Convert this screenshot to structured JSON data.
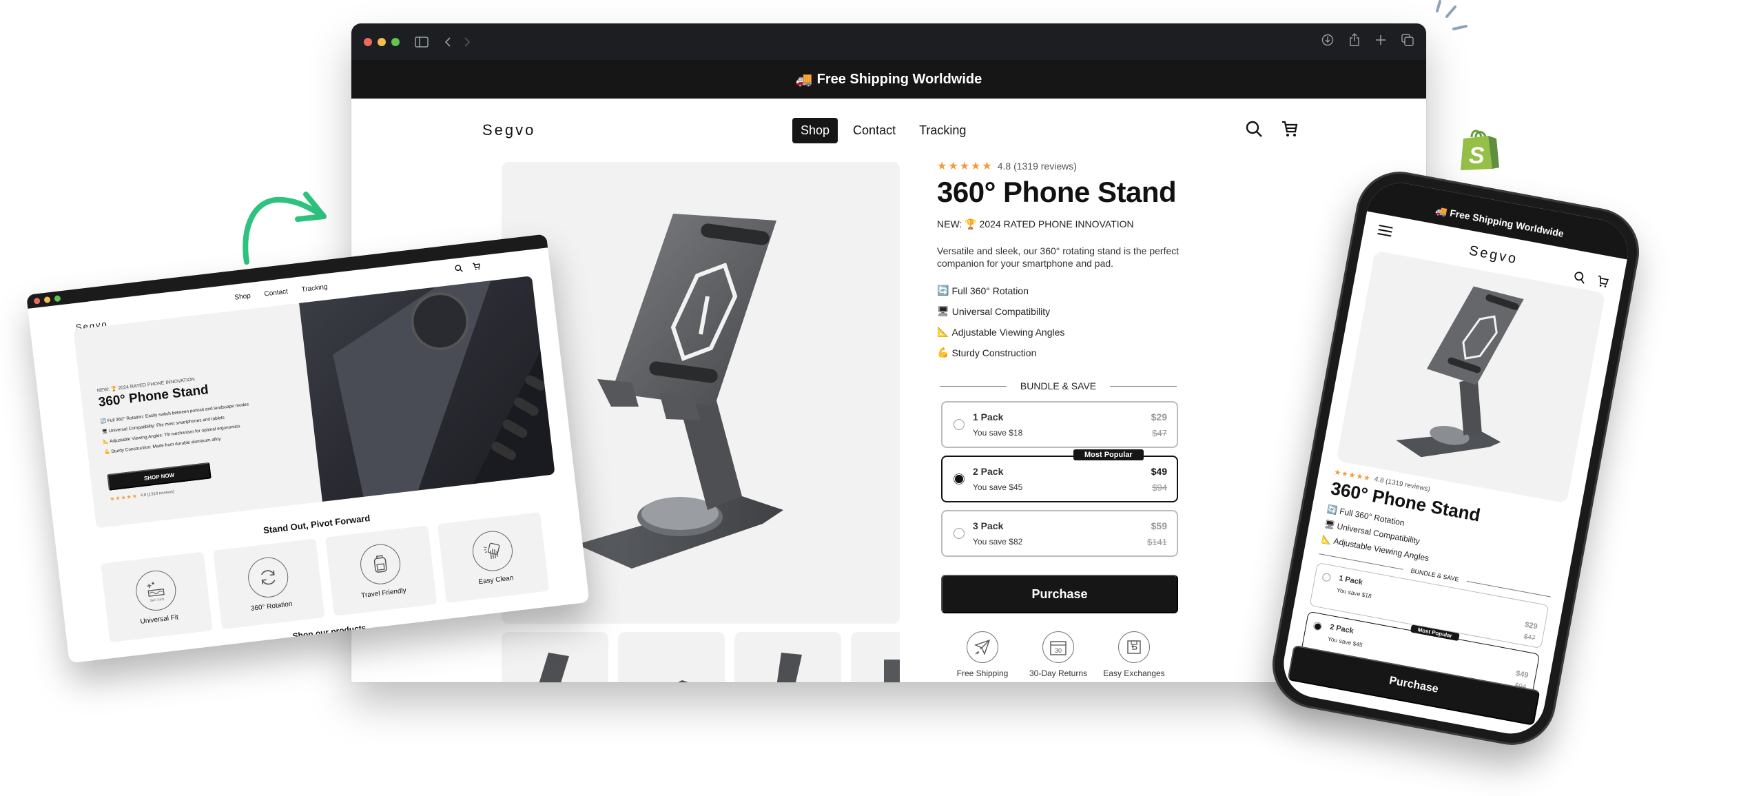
{
  "colors": {
    "accent_dark": "#161616",
    "star": "#f39a3c",
    "arrow_green": "#2dc27d",
    "shopify_green": "#5e9e3a"
  },
  "browser": {
    "toolbar_icons": [
      "sidebar-icon",
      "back-icon",
      "forward-icon",
      "download-icon",
      "share-icon",
      "new-tab-icon",
      "tabs-overview-icon"
    ]
  },
  "site": {
    "announcement": {
      "icon": "🚚",
      "text": "Free Shipping Worldwide"
    },
    "logo": "Segvo",
    "nav": [
      {
        "label": "Shop",
        "active": true
      },
      {
        "label": "Contact",
        "active": false
      },
      {
        "label": "Tracking",
        "active": false
      }
    ]
  },
  "product": {
    "stars": "★★★★★",
    "rating_text": "4.8 (1319 reviews)",
    "title": "360° Phone Stand",
    "badge_prefix": "NEW:",
    "badge_icon": "🏆",
    "badge_text": "2024 RATED PHONE INNOVATION",
    "description": "Versatile and sleek, our 360° rotating stand is the perfect companion for your smartphone and pad.",
    "features": [
      {
        "icon": "🔄",
        "text": "Full 360° Rotation"
      },
      {
        "icon": "🖥",
        "text": "Universal Compatibility"
      },
      {
        "icon": "📐",
        "text": "Adjustable Viewing Angles"
      },
      {
        "icon": "💪",
        "text": "Sturdy Construction"
      }
    ],
    "bundle_heading": "BUNDLE & SAVE",
    "packs": [
      {
        "name": "1 Pack",
        "save": "You save $18",
        "price": "$29",
        "old_price": "$47",
        "selected": false
      },
      {
        "name": "2 Pack",
        "save": "You save $45",
        "price": "$49",
        "old_price": "$94",
        "selected": true,
        "tag": "Most Popular"
      },
      {
        "name": "3 Pack",
        "save": "You save $82",
        "price": "$59",
        "old_price": "$141",
        "selected": false
      }
    ],
    "purchase_label": "Purchase",
    "trust": [
      {
        "icon": "paper-plane-icon",
        "label": "Free Shipping"
      },
      {
        "icon": "calendar-30-icon",
        "label": "30-Day Returns"
      },
      {
        "icon": "exchange-box-icon",
        "label": "Easy Exchanges"
      }
    ],
    "calendar_number": "30"
  },
  "landing": {
    "hero_badge": "NEW: 🏆 2024 RATED PHONE INNOVATION",
    "hero_title": "360° Phone Stand",
    "hero_features": [
      "🔄 Full 360° Rotation: Easily switch between portrait and landscape modes",
      "🖥 Universal Compatibility: Fits most smartphones and tablets",
      "📐 Adjustable Viewing Angles: Tilt mechanism for optimal ergonomics",
      "💪 Sturdy Construction: Made from durable aluminum alloy"
    ],
    "shop_now": "SHOP NOW",
    "section_title": "Stand Out, Pivot Forward",
    "cards": [
      {
        "label": "Universal Fit",
        "icon": "skin-safe-icon",
        "icon_text": "Skin Safe"
      },
      {
        "label": "360° Rotation",
        "icon": "rotate-icon"
      },
      {
        "label": "Travel Friendly",
        "icon": "backpack-icon"
      },
      {
        "label": "Easy Clean",
        "icon": "wipe-hand-icon"
      }
    ],
    "products_title": "Shop our products"
  },
  "mobile": {
    "features": [
      {
        "icon": "🔄",
        "text": "Full 360° Rotation"
      },
      {
        "icon": "🖥",
        "text": "Universal Compatibility"
      },
      {
        "icon": "📐",
        "text": "Adjustable Viewing Angles"
      }
    ]
  }
}
